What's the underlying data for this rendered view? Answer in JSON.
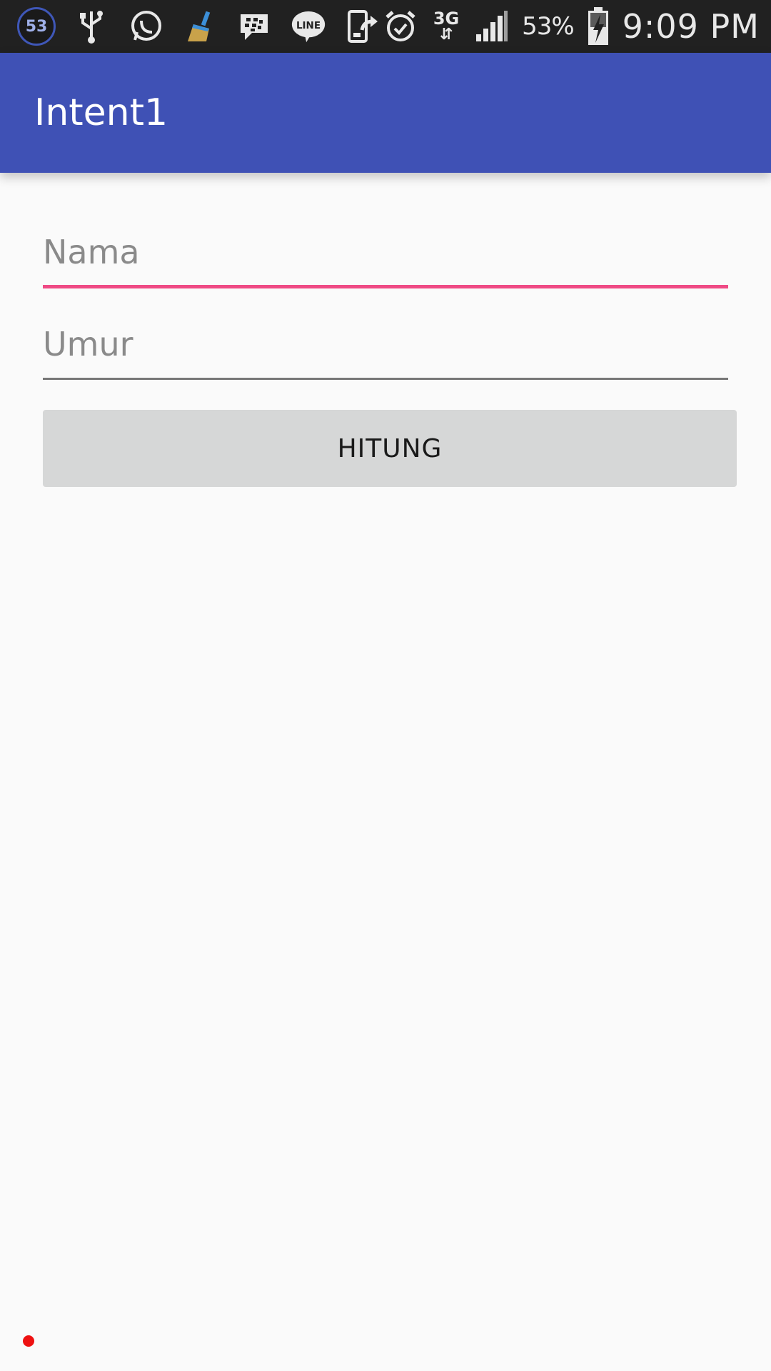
{
  "status_bar": {
    "notification_count": "53",
    "network_type": "3G",
    "battery_percent": "53%",
    "time": "9:09 PM",
    "left_icons": [
      "notification-count-icon",
      "usb-icon",
      "whatsapp-icon",
      "clean-master-icon",
      "bbm-icon",
      "line-icon",
      "phone-transfer-icon"
    ],
    "right_icons": [
      "alarm-icon",
      "network-type-indicator",
      "signal-icon",
      "battery-percent",
      "battery-charging-icon",
      "clock"
    ]
  },
  "app_bar": {
    "title": "Intent1",
    "color": "#3f51b5"
  },
  "form": {
    "nama": {
      "placeholder": "Nama",
      "value": "",
      "focused": true,
      "underline_color": "#ef4a85"
    },
    "umur": {
      "placeholder": "Umur",
      "value": ""
    },
    "hitung_label": "HITUNG"
  },
  "colors": {
    "status_bar": "#212121",
    "accent": "#ef4a85",
    "button_bg": "#d6d7d7",
    "background": "#fafafa"
  }
}
